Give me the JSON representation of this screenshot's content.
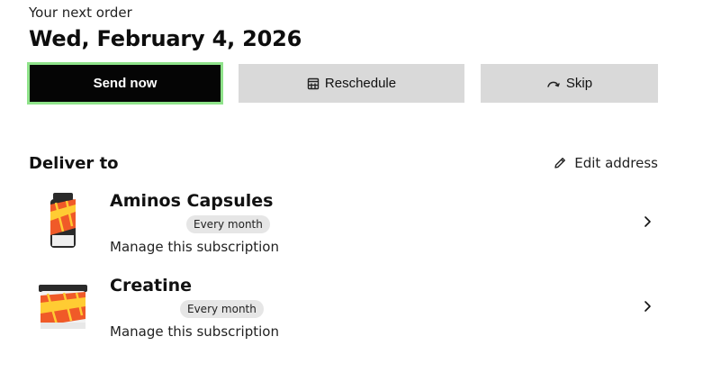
{
  "next_order": {
    "label": "Your next order",
    "date": "Wed, February 4, 2026"
  },
  "actions": {
    "send_now": "Send now",
    "reschedule": "Reschedule",
    "skip": "Skip",
    "icons": {
      "reschedule": "calendar-icon",
      "skip": "skip-arrow-icon"
    },
    "colors": {
      "send_bg": "#050505",
      "send_outline": "#8fe38a",
      "secondary_bg": "#d9d9d9"
    }
  },
  "delivery": {
    "title": "Deliver to",
    "edit_address": "Edit address",
    "edit_icon": "pencil-icon"
  },
  "subscriptions": [
    {
      "name": "Aminos Capsules",
      "frequency": "Every month",
      "manage": "Manage this subscription"
    },
    {
      "name": "Creatine",
      "frequency": "Every month",
      "manage": "Manage this subscription"
    }
  ]
}
